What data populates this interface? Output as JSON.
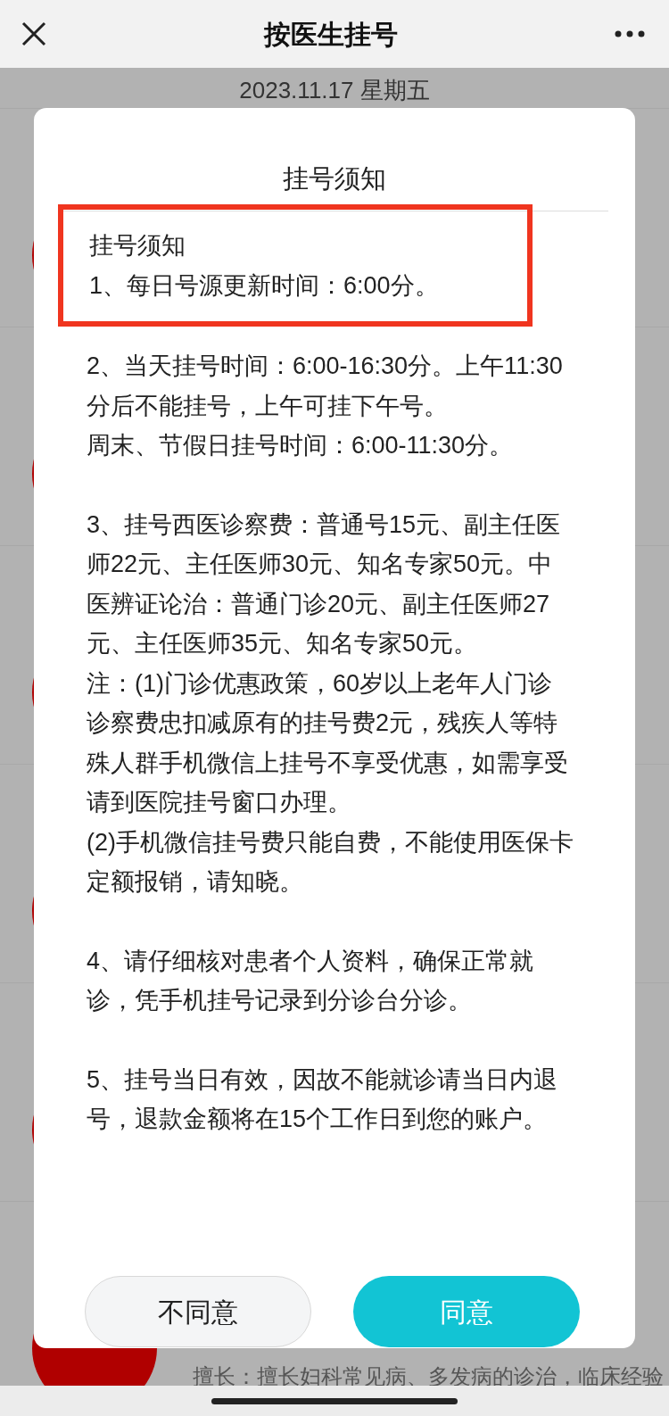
{
  "header": {
    "title": "按医生挂号"
  },
  "date": "2023.11.17 星期五",
  "doctor_rows": [
    {
      "avatar": true
    },
    {
      "avatar": true
    },
    {
      "avatar": true
    },
    {
      "avatar": true
    },
    {
      "avatar": true
    },
    {
      "avatar": true,
      "specialty": "擅长：擅长妇科常见病、多发病的诊治，临床经验"
    }
  ],
  "modal": {
    "title": "挂号须知",
    "highlighted_lines": [
      "挂号须知",
      "1、每日号源更新时间：6:00分。"
    ],
    "paragraphs": [
      [
        "2、当天挂号时间：6:00-16:30分。上午11:30分后不能挂号，上午可挂下午号。",
        "周末、节假日挂号时间：6:00-11:30分。"
      ],
      [
        "3、挂号西医诊察费：普通号15元、副主任医师22元、主任医师30元、知名专家50元。中医辨证论治：普通门诊20元、副主任医师27元、主任医师35元、知名专家50元。",
        "注：(1)门诊优惠政策，60岁以上老年人门诊诊察费忠扣减原有的挂号费2元，残疾人等特殊人群手机微信上挂号不享受优惠，如需享受请到医院挂号窗口办理。",
        "(2)手机微信挂号费只能自费，不能使用医保卡定额报销，请知晓。"
      ],
      [
        "4、请仔细核对患者个人资料，确保正常就诊，凭手机挂号记录到分诊台分诊。"
      ],
      [
        "5、挂号当日有效，因故不能就诊请当日内退号，退款金额将在15个工作日到您的账户。"
      ]
    ],
    "buttons": [
      {
        "label": "不同意",
        "kind": "secondary"
      },
      {
        "label": "同意",
        "kind": "primary"
      }
    ]
  }
}
